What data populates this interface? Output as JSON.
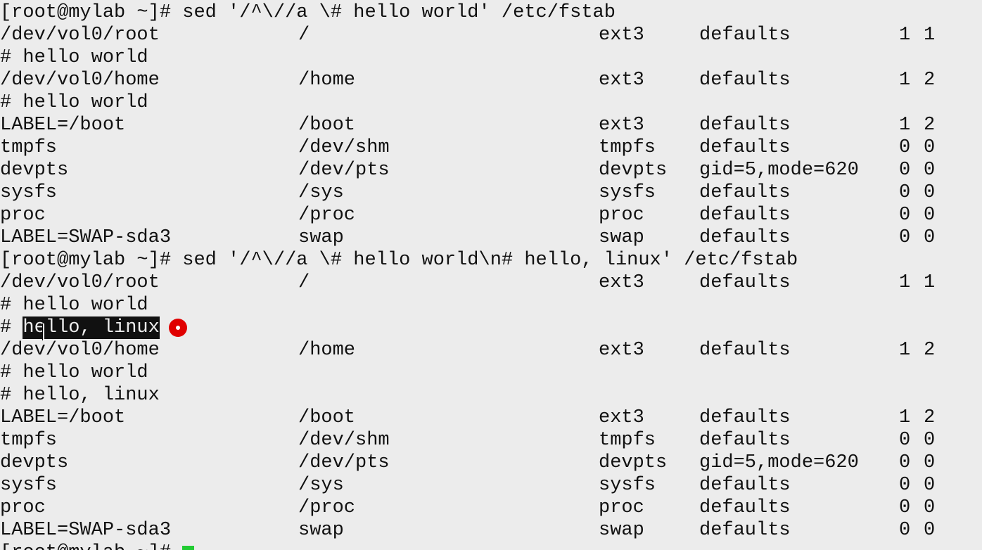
{
  "terminal": {
    "lines": [
      {
        "text": "[root@mylab ~]# sed '/^\\//a \\# hello world' /etc/fstab"
      },
      {
        "dev": "/dev/vol0/root",
        "mnt": "/",
        "fs": "ext3",
        "opt": "defaults",
        "d1": "1",
        "d2": "1"
      },
      {
        "text": "# hello world"
      },
      {
        "dev": "/dev/vol0/home",
        "mnt": "/home",
        "fs": "ext3",
        "opt": "defaults",
        "d1": "1",
        "d2": "2"
      },
      {
        "text": "# hello world"
      },
      {
        "dev": "LABEL=/boot",
        "mnt": "/boot",
        "fs": "ext3",
        "opt": "defaults",
        "d1": "1",
        "d2": "2"
      },
      {
        "dev": "tmpfs",
        "mnt": "/dev/shm",
        "fs": "tmpfs",
        "opt": "defaults",
        "d1": "0",
        "d2": "0"
      },
      {
        "dev": "devpts",
        "mnt": "/dev/pts",
        "fs": "devpts",
        "opt": "gid=5,mode=620",
        "d1": "0",
        "d2": "0"
      },
      {
        "dev": "sysfs",
        "mnt": "/sys",
        "fs": "sysfs",
        "opt": "defaults",
        "d1": "0",
        "d2": "0"
      },
      {
        "dev": "proc",
        "mnt": "/proc",
        "fs": "proc",
        "opt": "defaults",
        "d1": "0",
        "d2": "0"
      },
      {
        "dev": "LABEL=SWAP-sda3",
        "mnt": "swap",
        "fs": "swap",
        "opt": "defaults",
        "d1": "0",
        "d2": "0"
      },
      {
        "text": "[root@mylab ~]# sed '/^\\//a \\# hello world\\n# hello, linux' /etc/fstab"
      },
      {
        "dev": "/dev/vol0/root",
        "mnt": "/",
        "fs": "ext3",
        "opt": "defaults",
        "d1": "1",
        "d2": "1"
      },
      {
        "text": "# hello world"
      },
      {
        "prefix": "# ",
        "selected": "hello, linux"
      },
      {
        "dev": "/dev/vol0/home",
        "mnt": "/home",
        "fs": "ext3",
        "opt": "defaults",
        "d1": "1",
        "d2": "2"
      },
      {
        "text": "# hello world"
      },
      {
        "text": "# hello, linux"
      },
      {
        "dev": "LABEL=/boot",
        "mnt": "/boot",
        "fs": "ext3",
        "opt": "defaults",
        "d1": "1",
        "d2": "2"
      },
      {
        "dev": "tmpfs",
        "mnt": "/dev/shm",
        "fs": "tmpfs",
        "opt": "defaults",
        "d1": "0",
        "d2": "0"
      },
      {
        "dev": "devpts",
        "mnt": "/dev/pts",
        "fs": "devpts",
        "opt": "gid=5,mode=620",
        "d1": "0",
        "d2": "0"
      },
      {
        "dev": "sysfs",
        "mnt": "/sys",
        "fs": "sysfs",
        "opt": "defaults",
        "d1": "0",
        "d2": "0"
      },
      {
        "dev": "proc",
        "mnt": "/proc",
        "fs": "proc",
        "opt": "defaults",
        "d1": "0",
        "d2": "0"
      },
      {
        "dev": "LABEL=SWAP-sda3",
        "mnt": "swap",
        "fs": "swap",
        "opt": "defaults",
        "d1": "0",
        "d2": "0"
      },
      {
        "text": "[root@mylab ~]# ",
        "cursor": true
      }
    ]
  },
  "colors": {
    "background": "#ececec",
    "foreground": "#111111",
    "cursor": "#22cc33",
    "recording_marker": "#e00000"
  },
  "icons": {
    "recording_marker": "record-dot-icon",
    "mouse_pointer": "text-cursor-icon"
  }
}
